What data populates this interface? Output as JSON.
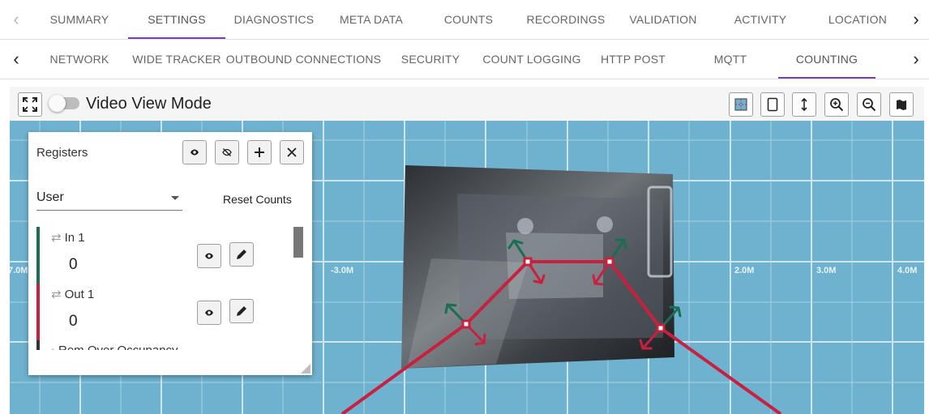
{
  "top_tabs": {
    "items": [
      "SUMMARY",
      "SETTINGS",
      "DIAGNOSTICS",
      "META DATA",
      "COUNTS",
      "RECORDINGS",
      "VALIDATION",
      "ACTIVITY",
      "LOCATION"
    ],
    "active": "SETTINGS",
    "prev_icon": "chevron-left-icon",
    "next_icon": "chevron-right-icon"
  },
  "sub_tabs": {
    "items": [
      "NETWORK",
      "WIDE TRACKER",
      "OUTBOUND CONNECTIONS",
      "SECURITY",
      "COUNT LOGGING",
      "HTTP POST",
      "MQTT",
      "COUNTING"
    ],
    "active": "COUNTING",
    "prev_icon": "chevron-left-icon",
    "next_icon": "chevron-right-icon"
  },
  "toolbar": {
    "video_view_mode_label": "Video View Mode",
    "video_view_mode_on": false,
    "left_icon": "fullscreen-icon",
    "right_icons": [
      "floorplan-icon",
      "portrait-icon",
      "vertical-fit-icon",
      "zoom-in-icon",
      "zoom-out-icon",
      "map-icon"
    ]
  },
  "floor_map": {
    "axis_labels": [
      "7.0M",
      "-3.0M",
      "2.0M",
      "3.0M",
      "4.0M"
    ]
  },
  "registers": {
    "title": "Registers",
    "header_icons": [
      "eye-icon",
      "eye-off-icon",
      "add-icon",
      "close-icon"
    ],
    "filter_value": "User",
    "reset_label": "Reset Counts",
    "items": [
      {
        "name": "In 1",
        "count": "0",
        "color": "#1b6e53"
      },
      {
        "name": "Out 1",
        "count": "0",
        "color": "#c8203f"
      },
      {
        "name": "Rem Over Occupancy",
        "count": "",
        "color": "#333333"
      }
    ]
  },
  "colors": {
    "tab_indicator": "#7b3fb0",
    "map_background": "#6fb2cf",
    "grid_line": "#d6ecf3",
    "count_line": "#c8203f",
    "arrow_in": "#1b6e53",
    "arrow_out": "#c8203f"
  }
}
